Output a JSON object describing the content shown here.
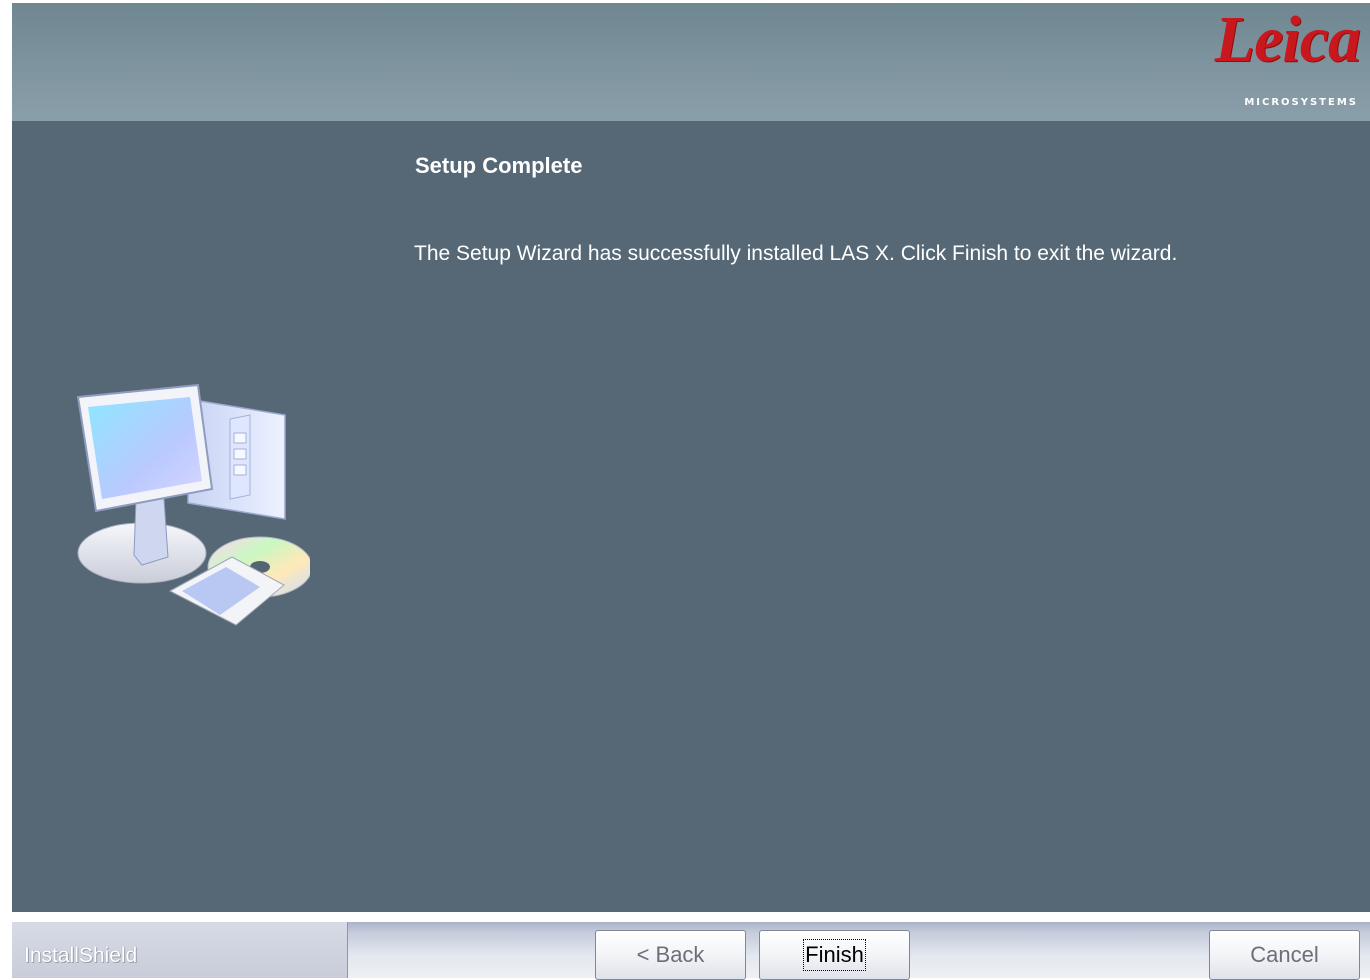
{
  "header": {
    "logo_text": "Leica",
    "logo_subtitle": "MICROSYSTEMS"
  },
  "content": {
    "title": "Setup Complete",
    "message": "The Setup Wizard has successfully installed LAS X.  Click Finish to exit the wizard."
  },
  "illustration": {
    "icon": "computer-install-icon"
  },
  "footer": {
    "brand": "InstallShield",
    "buttons": {
      "back_label": "< Back",
      "finish_label": "Finish",
      "cancel_label": "Cancel"
    }
  },
  "colors": {
    "header_bg": "#7d939d",
    "content_bg": "#566875",
    "logo_red": "#c8171d",
    "text": "#ffffff"
  }
}
